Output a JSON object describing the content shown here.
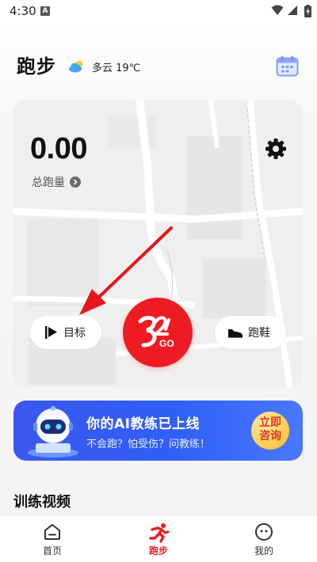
{
  "status_bar": {
    "time": "4:30",
    "notification_letter": "A"
  },
  "header": {
    "title": "跑步",
    "weather_icon": "cloud-sun-icon",
    "weather": "多云 19℃",
    "calendar_icon": "calendar-icon"
  },
  "stats": {
    "distance": "0.00",
    "distance_label": "总跑量",
    "settings_icon": "gear-icon"
  },
  "controls": {
    "goal_label": "目标",
    "goal_icon": "flag-play-icon",
    "start_logo": "32GO",
    "start_sub": "GO",
    "shoes_label": "跑鞋",
    "shoes_icon": "shoe-icon"
  },
  "ai_banner": {
    "title": "你的AI教练已上线",
    "subtitle": "不会跑？怕受伤？问教练！",
    "cta_line1": "立即",
    "cta_line2": "咨询"
  },
  "section": {
    "title": "训练视频"
  },
  "bottom_nav": [
    {
      "label": "首页",
      "icon": "home-icon"
    },
    {
      "label": "跑步",
      "icon": "runner-icon",
      "active": true
    },
    {
      "label": "我的",
      "icon": "smiley-icon"
    }
  ],
  "colors": {
    "accent": "#ef1b23",
    "banner_blue": "#2f5ff6",
    "cta_gold": "#ffcf54"
  }
}
